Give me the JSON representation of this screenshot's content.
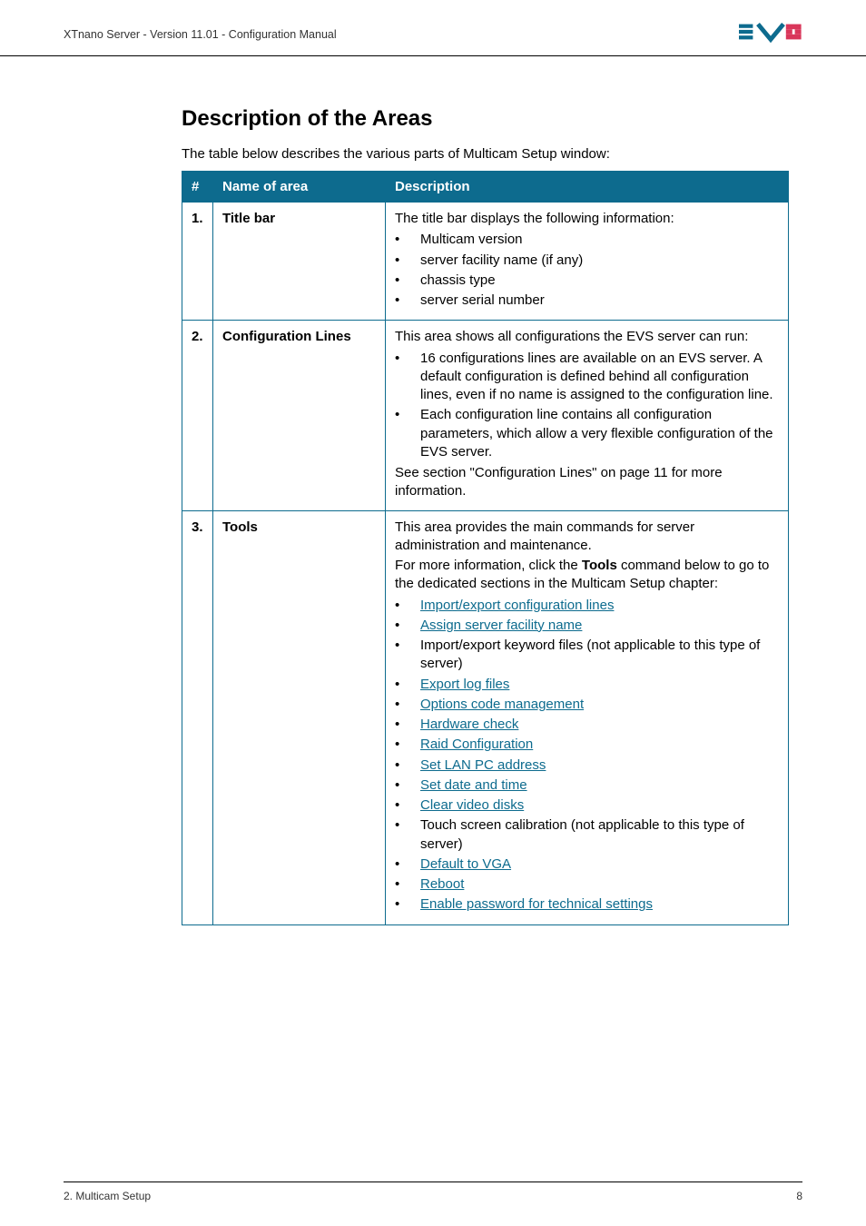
{
  "header": {
    "doc_title": "XTnano Server - Version 11.01 - Configuration Manual"
  },
  "section": {
    "title": "Description of the Areas",
    "intro": "The table below describes the various parts of Multicam Setup window:"
  },
  "table": {
    "headers": {
      "num": "#",
      "name": "Name of area",
      "desc": "Description"
    },
    "row1": {
      "num": "1.",
      "name": "Title bar",
      "desc_lead": "The title bar displays the following information:",
      "b1": "Multicam version",
      "b2": "server facility name (if any)",
      "b3": "chassis type",
      "b4": "server serial number"
    },
    "row2": {
      "num": "2.",
      "name": "Configuration Lines",
      "desc_lead": "This area shows all configurations the EVS server can run:",
      "b1": "16 configurations lines are available on an EVS server. A default configuration is defined behind all configuration lines, even if no name is assigned to the configuration line.",
      "b2": "Each configuration line contains all configuration parameters, which allow a very flexible configuration of the EVS server.",
      "desc_tail": "See section \"Configuration Lines\" on page 11 for more information."
    },
    "row3": {
      "num": "3.",
      "name": "Tools",
      "p1": "This area provides the main commands for server administration and maintenance.",
      "p2a": "For more information, click the ",
      "p2b": "Tools",
      "p2c": " command below to go to the dedicated sections in the Multicam Setup chapter:",
      "l1": "Import/export configuration lines",
      "l2": "Assign server facility name",
      "b3": "Import/export keyword files (not applicable to this type of server)",
      "l4": "Export log files",
      "l5": "Options code management",
      "l6": "Hardware check",
      "l7": "Raid Configuration",
      "l8": "Set LAN PC address",
      "l9": "Set date and time",
      "l10": "Clear video disks",
      "b11": "Touch screen calibration   (not applicable to this type of server)",
      "l12": "Default to VGA",
      "l13": "Reboot",
      "l14": "Enable password for technical settings"
    }
  },
  "footer": {
    "left": "2. Multicam Setup",
    "right": "8"
  }
}
